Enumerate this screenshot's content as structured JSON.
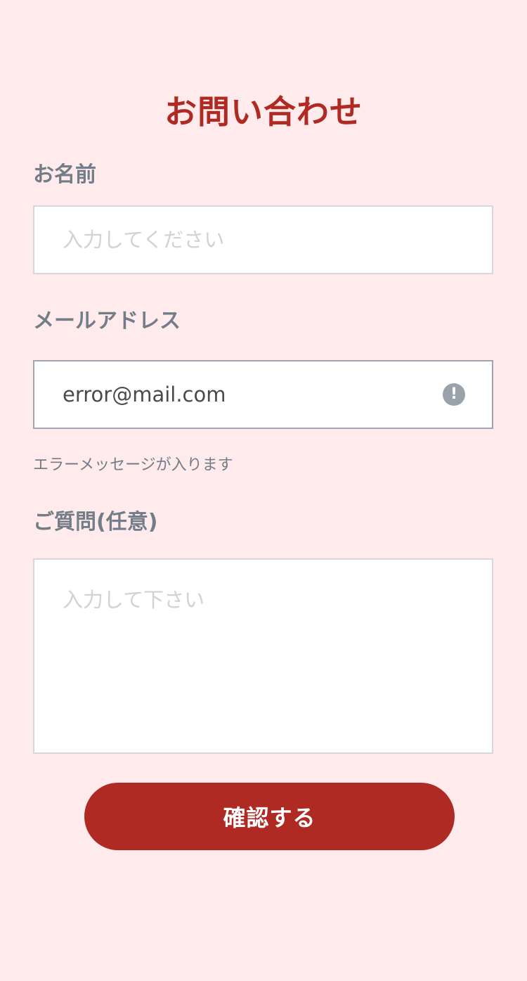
{
  "page": {
    "title": "お問い合わせ"
  },
  "form": {
    "name": {
      "label": "お名前",
      "placeholder": "入力してください",
      "value": ""
    },
    "email": {
      "label": "メールアドレス",
      "value": "error@mail.com",
      "error_icon": "exclamation-circle-icon",
      "error_icon_glyph": "!",
      "error_message": "エラーメッセージが入ります"
    },
    "question": {
      "label": "ご質問(任意)",
      "placeholder": "入力して下さい",
      "value": ""
    },
    "submit_label": "確認する"
  },
  "colors": {
    "background": "#ffebeb",
    "accent": "#b02a24",
    "label": "#737d87",
    "placeholder": "#cfd3d7",
    "input_border": "#d3d8dd",
    "error_border": "#9ea7b0",
    "error_icon": "#99a2ab"
  }
}
